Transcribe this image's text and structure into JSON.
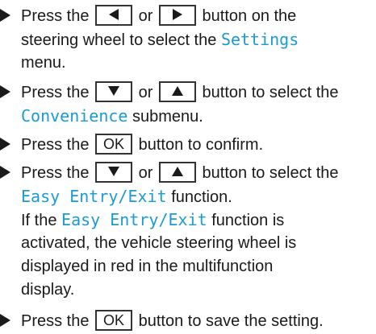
{
  "colors": {
    "display_text": "#1a9ad6",
    "text": "#1a1a1a"
  },
  "step1": {
    "press_the": "Press the",
    "key_left": "left-arrow-key",
    "or": "or",
    "key_right": "right-arrow-key",
    "after": "button on the",
    "line2a": "steering wheel to select the",
    "display": "Settings",
    "line3": "menu."
  },
  "step2": {
    "press_the": "Press the",
    "or": "or",
    "after": "button to select the",
    "display": "Convenience",
    "line2b": "submenu."
  },
  "step3": {
    "press_the": "Press the",
    "key_ok": "OK",
    "after": "button to confirm."
  },
  "step4": {
    "press_the": "Press the",
    "or": "or",
    "after": "button to select the",
    "display": "Easy Entry/Exit",
    "line2b": "function.",
    "line3a": "If the",
    "display2": "Easy Entry/Exit",
    "line3b": "function is",
    "line4": "activated, the vehicle steering wheel is",
    "line5": "displayed in red in the multifunction",
    "line6": "display."
  },
  "step5": {
    "press_the": "Press the",
    "key_ok": "OK",
    "after": "button to save the setting."
  }
}
